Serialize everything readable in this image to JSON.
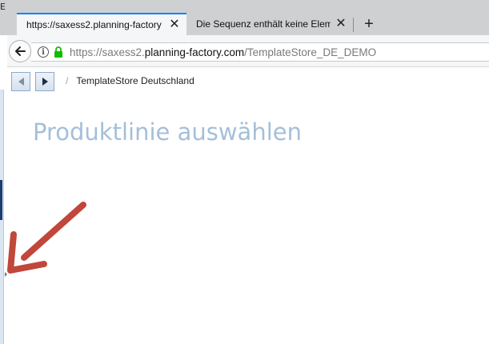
{
  "tabs": [
    {
      "label": "https://saxess2.planning-factory",
      "active": true
    },
    {
      "label": "Die Sequenz enthält keine Eleme",
      "active": false
    }
  ],
  "new_tab_label": "+",
  "close_glyph": "✕",
  "url": {
    "scheme": "https://saxess2.",
    "host": "planning-factory.com",
    "path": "/TemplateStore_DE_DEMO"
  },
  "left_edge_letter": "E",
  "breadcrumb": {
    "separator": "/",
    "current": "TemplateStore Deutschland"
  },
  "page": {
    "title": "Produktlinie auswählen"
  },
  "colors": {
    "accent": "#0a84ff",
    "title": "#a5bfd9",
    "annotation_arrow": "#c0473a",
    "lock": "#12bc00"
  },
  "icons": [
    "back-arrow-icon",
    "info-icon",
    "lock-icon",
    "close-icon",
    "plus-icon",
    "nav-prev-icon",
    "nav-next-icon",
    "annotation-arrow-icon"
  ]
}
